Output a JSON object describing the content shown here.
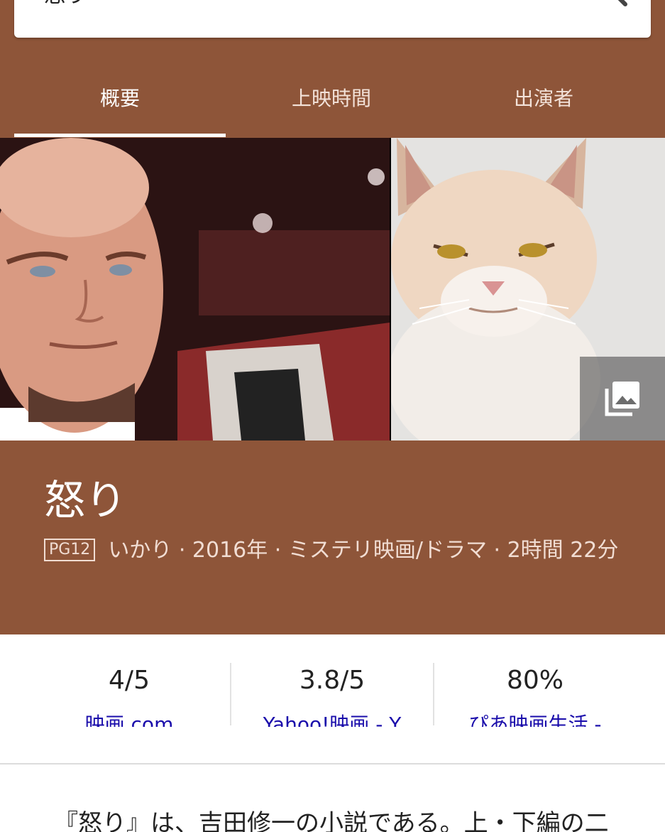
{
  "search": {
    "query": "怒り"
  },
  "tabs": [
    {
      "label": "概要"
    },
    {
      "label": "上映時間"
    },
    {
      "label": "出演者"
    }
  ],
  "movie": {
    "title": "怒り",
    "rating_badge": "PG12",
    "meta_line": "いかり · 2016年 · ミステリ映画/ドラマ · 2時間 22分"
  },
  "ratings": [
    {
      "score": "4/5",
      "source": "映画.com"
    },
    {
      "score": "3.8/5",
      "source": "Yahoo!映画 - Y"
    },
    {
      "score": "80%",
      "source": "ぴあ映画生活 -"
    }
  ],
  "description": "『怒り』は、吉田修一の小説である。上・下編の二",
  "colors": {
    "brand_brown": "#8e5539",
    "link_blue": "#1a0dab"
  }
}
